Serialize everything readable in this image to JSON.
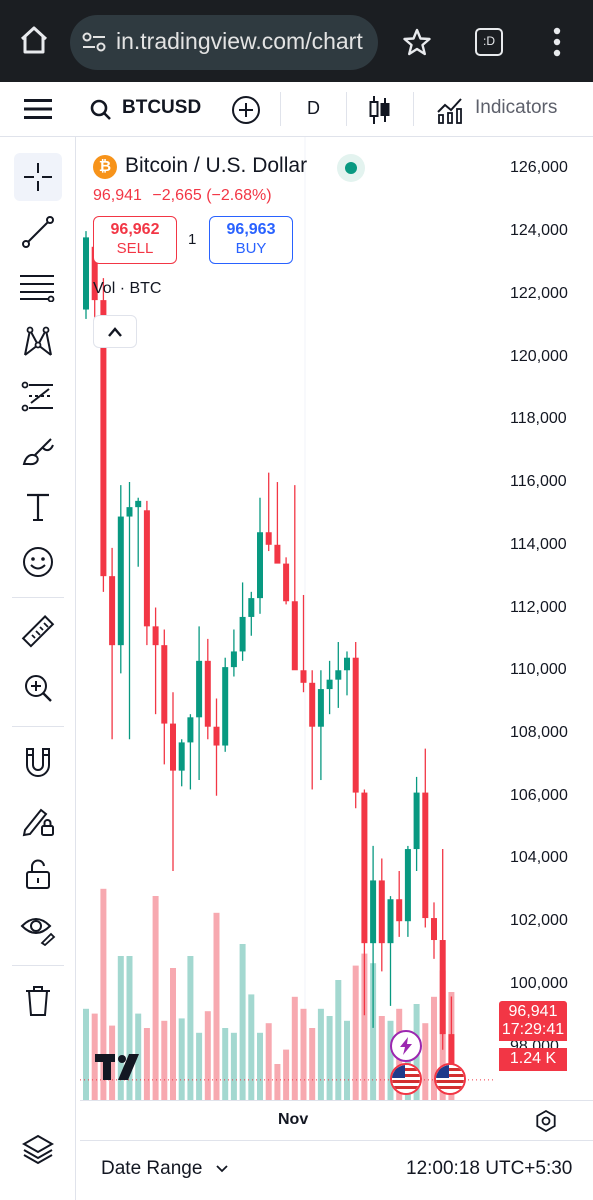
{
  "browser": {
    "url": "in.tradingview.com/chart",
    "tab_switcher_label": ":D"
  },
  "toolbar": {
    "symbol": "BTCUSD",
    "interval": "D",
    "indicators_label": "Indicators"
  },
  "legend": {
    "title": "Bitcoin / U.S. Dollar",
    "last": "96,941",
    "change": "−2,665 (−2.68%)",
    "sell_price": "96,962",
    "sell_label": "SELL",
    "buy_price": "96,963",
    "buy_label": "BUY",
    "quantity": "1",
    "volume_label": "Vol · BTC",
    "market_status_color": "#089981"
  },
  "price_scale": {
    "ticks": [
      "126,000",
      "124,000",
      "122,000",
      "120,000",
      "118,000",
      "116,000",
      "114,000",
      "112,000",
      "110,000",
      "108,000",
      "106,000",
      "104,000",
      "102,000",
      "100,000",
      "98,000"
    ],
    "last_price_label": "96,941",
    "countdown_label": "17:29:41",
    "volume_label": "1.24 K"
  },
  "time_scale": {
    "labels": [
      "Nov"
    ]
  },
  "bottom_bar": {
    "date_range_label": "Date Range",
    "clock": "12:00:18 UTC+5:30"
  },
  "colors": {
    "up": "#089981",
    "down": "#f23645",
    "up_volume": "#a3d8d0",
    "down_volume": "#f7a9b0",
    "browser_bar": "#1b1e22"
  },
  "icons": {
    "home": "home-icon",
    "site_settings": "site-settings-icon",
    "bookmark": "star-icon",
    "menu": "more-vertical-icon"
  },
  "chart_data": {
    "type": "candlestick",
    "ylim": [
      96300,
      127000
    ],
    "series": [
      {
        "name": "BTCUSD",
        "candles": [
          {
            "o": 121500,
            "h": 124000,
            "l": 121200,
            "c": 123800
          },
          {
            "o": 123500,
            "h": 123700,
            "l": 121000,
            "c": 121800
          },
          {
            "o": 121800,
            "h": 122500,
            "l": 112500,
            "c": 113000
          },
          {
            "o": 113000,
            "h": 113900,
            "l": 107800,
            "c": 110800
          },
          {
            "o": 110800,
            "h": 115900,
            "l": 109900,
            "c": 114900
          },
          {
            "o": 114900,
            "h": 116000,
            "l": 107800,
            "c": 115200
          },
          {
            "o": 115200,
            "h": 115500,
            "l": 113300,
            "c": 115400
          },
          {
            "o": 115100,
            "h": 115400,
            "l": 110800,
            "c": 111400
          },
          {
            "o": 111400,
            "h": 112000,
            "l": 108600,
            "c": 110800
          },
          {
            "o": 110800,
            "h": 111300,
            "l": 107000,
            "c": 108300
          },
          {
            "o": 108300,
            "h": 109300,
            "l": 103600,
            "c": 106800
          },
          {
            "o": 106800,
            "h": 107800,
            "l": 106300,
            "c": 107700
          },
          {
            "o": 107700,
            "h": 108600,
            "l": 106200,
            "c": 108500
          },
          {
            "o": 108500,
            "h": 111400,
            "l": 106500,
            "c": 110300
          },
          {
            "o": 110300,
            "h": 111000,
            "l": 107800,
            "c": 108200
          },
          {
            "o": 108200,
            "h": 109100,
            "l": 106000,
            "c": 107600
          },
          {
            "o": 107600,
            "h": 110400,
            "l": 107400,
            "c": 110100
          },
          {
            "o": 110100,
            "h": 111300,
            "l": 109800,
            "c": 110600
          },
          {
            "o": 110600,
            "h": 112800,
            "l": 110300,
            "c": 111700
          },
          {
            "o": 111700,
            "h": 112500,
            "l": 111100,
            "c": 112300
          },
          {
            "o": 112300,
            "h": 115500,
            "l": 111800,
            "c": 114400
          },
          {
            "o": 114400,
            "h": 116300,
            "l": 113800,
            "c": 114000
          },
          {
            "o": 114000,
            "h": 116000,
            "l": 113600,
            "c": 113400
          },
          {
            "o": 113400,
            "h": 113600,
            "l": 112100,
            "c": 112200
          },
          {
            "o": 112200,
            "h": 115900,
            "l": 110200,
            "c": 110000
          },
          {
            "o": 110000,
            "h": 112400,
            "l": 109300,
            "c": 109600
          },
          {
            "o": 109600,
            "h": 110000,
            "l": 106200,
            "c": 108200
          },
          {
            "o": 108200,
            "h": 110000,
            "l": 106500,
            "c": 109400
          },
          {
            "o": 109400,
            "h": 110300,
            "l": 108600,
            "c": 109700
          },
          {
            "o": 109700,
            "h": 110900,
            "l": 108800,
            "c": 110000
          },
          {
            "o": 110000,
            "h": 110600,
            "l": 109200,
            "c": 110400
          },
          {
            "o": 110400,
            "h": 110900,
            "l": 105600,
            "c": 106100
          },
          {
            "o": 106100,
            "h": 106200,
            "l": 99000,
            "c": 101300
          },
          {
            "o": 101300,
            "h": 104400,
            "l": 98600,
            "c": 103300
          },
          {
            "o": 103300,
            "h": 104000,
            "l": 100400,
            "c": 101300
          },
          {
            "o": 101300,
            "h": 102800,
            "l": 99300,
            "c": 102700
          },
          {
            "o": 102700,
            "h": 103600,
            "l": 101500,
            "c": 102000
          },
          {
            "o": 102000,
            "h": 104400,
            "l": 101500,
            "c": 104300
          },
          {
            "o": 104300,
            "h": 106600,
            "l": 103600,
            "c": 106100
          },
          {
            "o": 106100,
            "h": 107500,
            "l": 101800,
            "c": 102100
          },
          {
            "o": 102100,
            "h": 102600,
            "l": 100800,
            "c": 101400
          },
          {
            "o": 101400,
            "h": 104300,
            "l": 97900,
            "c": 98400
          },
          {
            "o": 98400,
            "h": 99600,
            "l": 97400,
            "c": 96941
          }
        ]
      },
      {
        "name": "Vol · BTC",
        "values": [
          0.38,
          0.36,
          0.88,
          0.31,
          0.6,
          0.6,
          0.36,
          0.3,
          0.85,
          0.33,
          0.55,
          0.34,
          0.6,
          0.28,
          0.37,
          0.78,
          0.3,
          0.28,
          0.65,
          0.44,
          0.28,
          0.32,
          0.15,
          0.21,
          0.43,
          0.38,
          0.3,
          0.38,
          0.35,
          0.5,
          0.33,
          0.56,
          0.61,
          0.57,
          0.35,
          0.33,
          0.38,
          0.26,
          0.4,
          0.32,
          0.43,
          0.54,
          0.45
        ]
      }
    ]
  }
}
